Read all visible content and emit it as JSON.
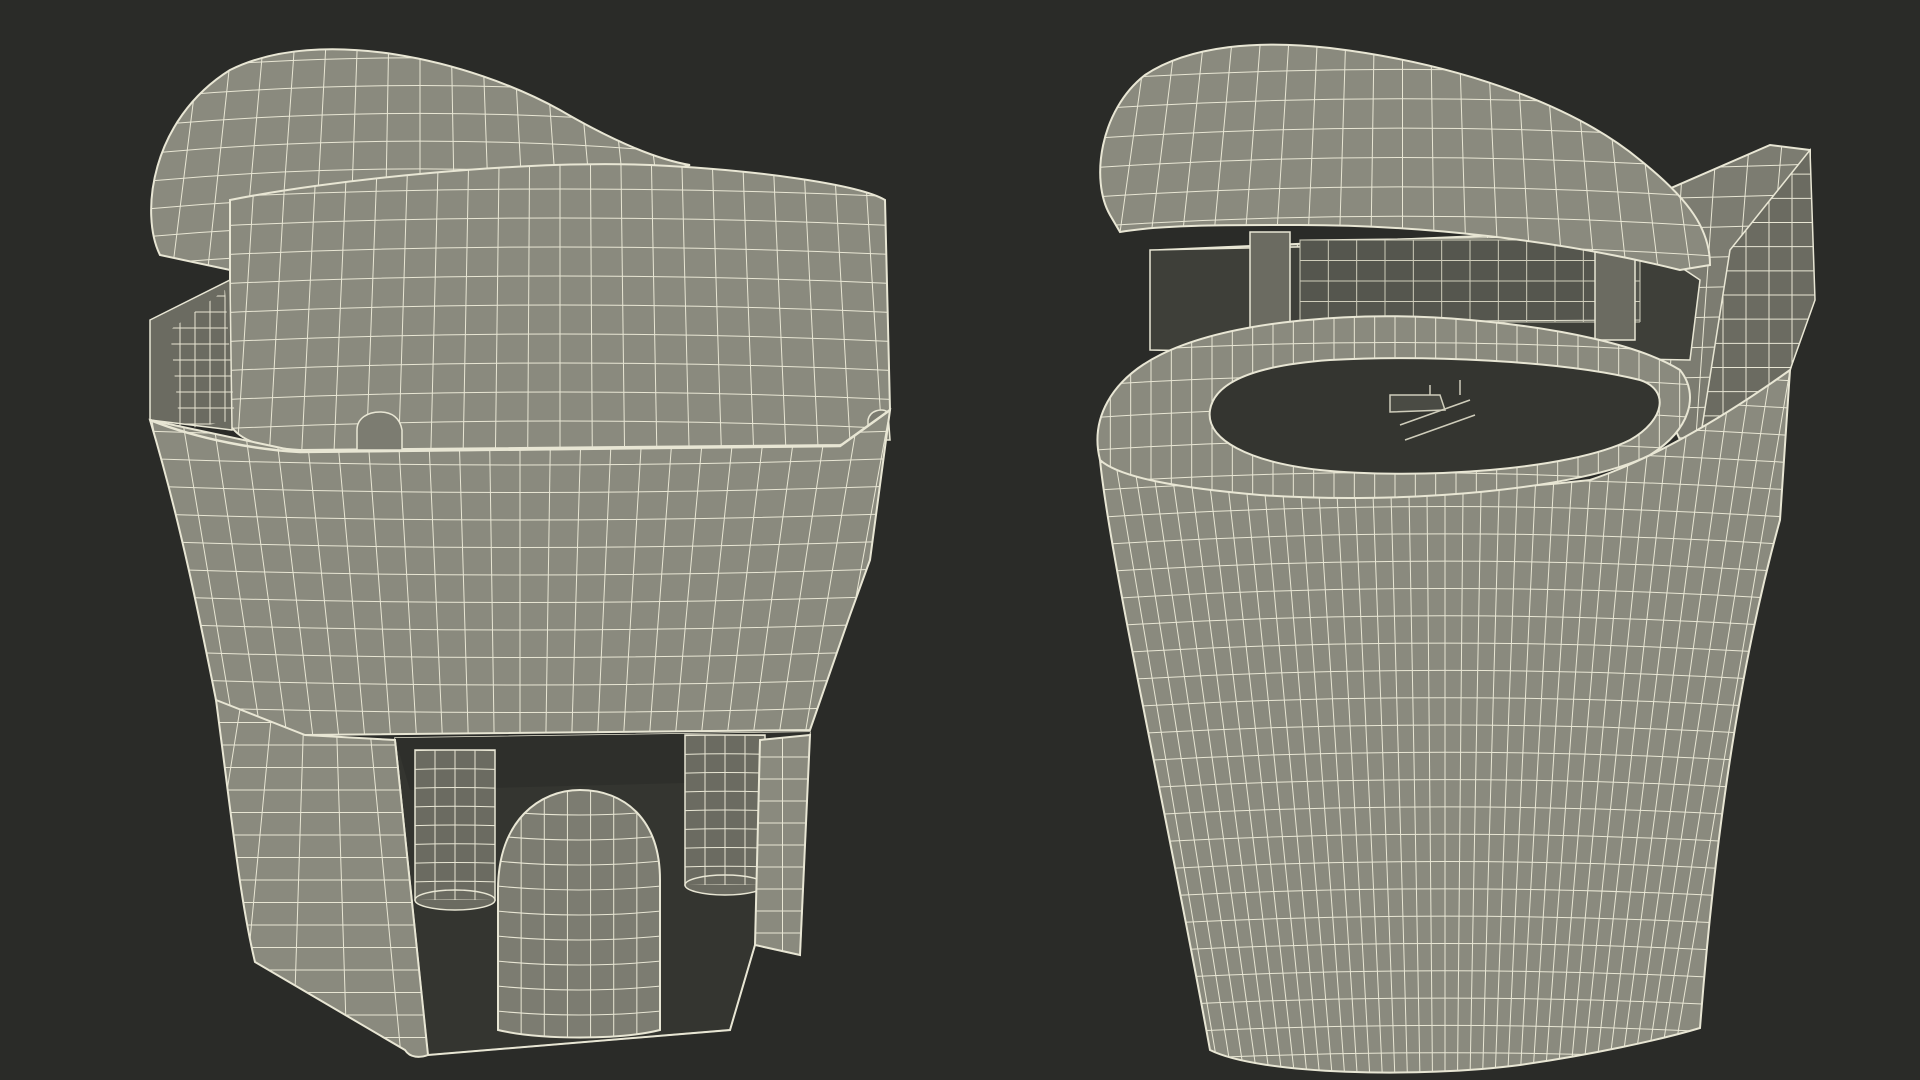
{
  "scene": {
    "subject": "wireframe-render",
    "colors": {
      "background": "#2a2b28",
      "surface": "#8a8a7e",
      "surface_dark": "#6b6b61",
      "surface_light": "#9a9a8e",
      "shadow": "#3a3b36",
      "cavity": "#343530",
      "wire": "#e8e6d4",
      "wire_soft": "#cfcdbb"
    },
    "views": [
      {
        "id": "rear-view",
        "icon": "toilet-rear-wireframe-icon"
      },
      {
        "id": "front-view",
        "icon": "toilet-front-wireframe-icon"
      }
    ]
  }
}
